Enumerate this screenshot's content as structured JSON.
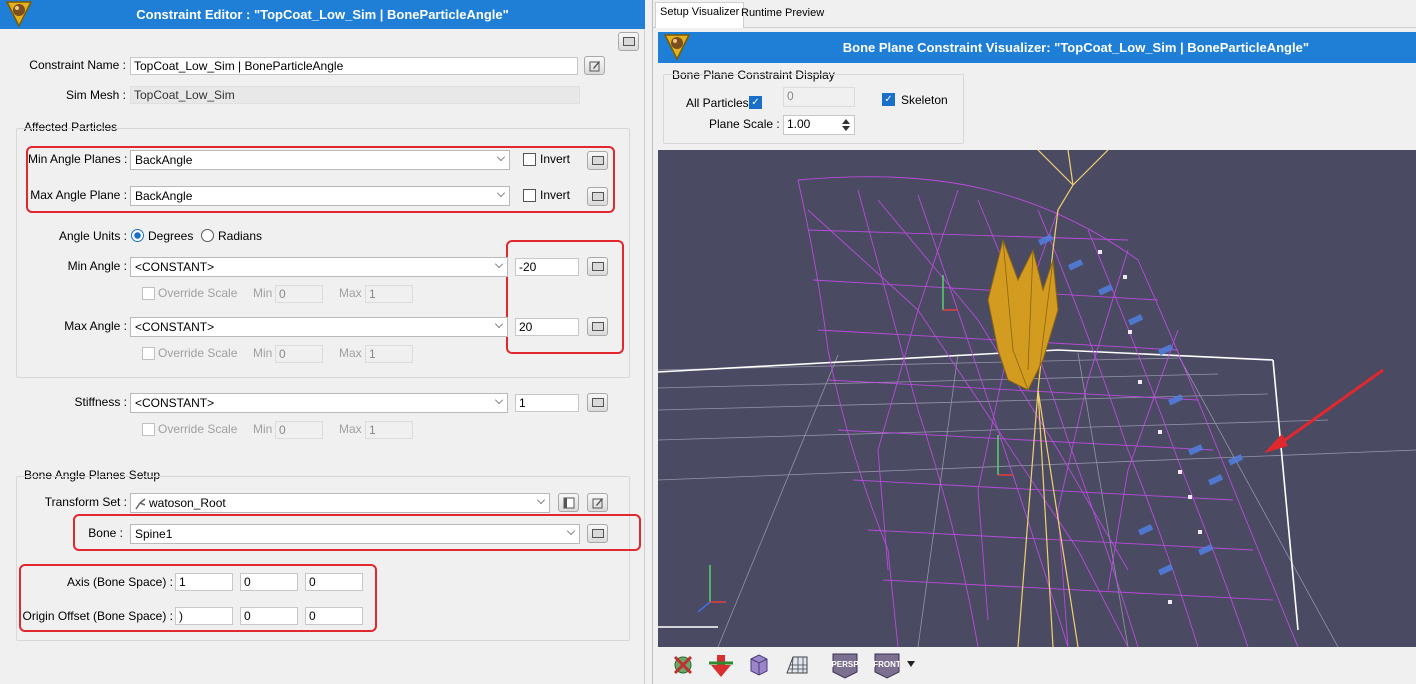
{
  "editor": {
    "title": "Constraint Editor : \"TopCoat_Low_Sim | BoneParticleAngle\"",
    "constraint_name_label": "Constraint Name :",
    "constraint_name": "TopCoat_Low_Sim | BoneParticleAngle",
    "sim_mesh_label": "Sim Mesh :",
    "sim_mesh": "TopCoat_Low_Sim",
    "affected_particles": {
      "heading": "Affected Particles",
      "min_planes_label": "Min Angle Planes :",
      "min_planes_value": "BackAngle",
      "max_plane_label": "Max Angle Plane :",
      "max_plane_value": "BackAngle",
      "invert_label": "Invert",
      "angle_units_label": "Angle Units :",
      "degrees": "Degrees",
      "radians": "Radians",
      "min_angle_label": "Min Angle :",
      "min_angle_mode": "<CONSTANT>",
      "min_angle_value": "-20",
      "max_angle_label": "Max Angle :",
      "max_angle_mode": "<CONSTANT>",
      "max_angle_value": "20",
      "override_scale": "Override Scale",
      "min_label": "Min",
      "max_label": "Max",
      "scale_min": "0",
      "scale_max": "1"
    },
    "stiffness_label": "Stiffness :",
    "stiffness_mode": "<CONSTANT>",
    "stiffness_value": "1",
    "bone_setup": {
      "heading": "Bone Angle Planes Setup",
      "transform_set_label": "Transform Set :",
      "transform_set": "watoson_Root",
      "bone_label": "Bone :",
      "bone": "Spine1",
      "axis_label": "Axis (Bone Space) :",
      "axis": [
        "1",
        "0",
        "0"
      ],
      "origin_label": "Origin Offset (Bone Space) :",
      "origin": [
        ")",
        "0",
        "0"
      ]
    }
  },
  "visualizer": {
    "tabs": [
      "Setup Visualizer",
      "Runtime Preview"
    ],
    "title": "Bone Plane Constraint Visualizer: \"TopCoat_Low_Sim | BoneParticleAngle\"",
    "display_heading": "Bone Plane Constraint Display",
    "all_particles_label": "All Particles",
    "particle_index": "0",
    "skeleton_label": "Skeleton",
    "plane_scale_label": "Plane Scale :",
    "plane_scale": "1.00",
    "toolbar": [
      "PERSP",
      "FRONT"
    ]
  },
  "colors": {
    "title_bar": "#1f7fd6",
    "highlight": "#e0282e",
    "viewport": "#4b4a63",
    "mesh": "#c44ce8",
    "bone": "#d9a420"
  }
}
